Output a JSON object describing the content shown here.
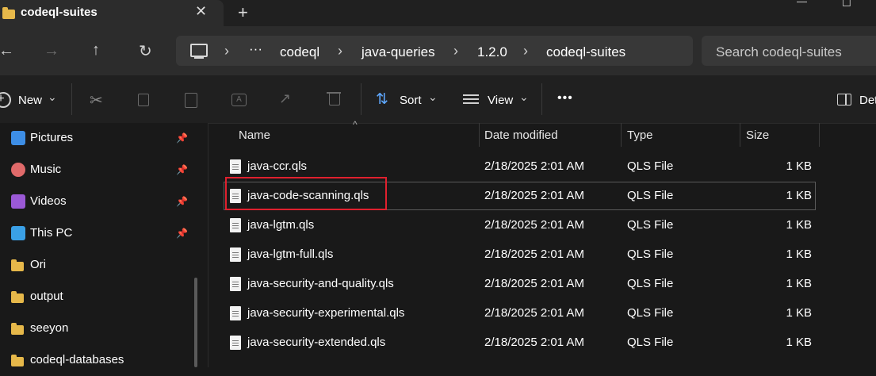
{
  "window": {
    "tab_title": "codeql-suites",
    "close_glyph": "✕",
    "new_tab_glyph": "+",
    "min_glyph": "—",
    "max_glyph": "☐"
  },
  "nav": {
    "back_glyph": "←",
    "forward_glyph": "→",
    "up_glyph": "↑",
    "refresh_glyph": "↻",
    "pc_glyph": "🖵",
    "more_glyph": "···",
    "breadcrumbs": [
      "codeql",
      "java-queries",
      "1.2.0",
      "codeql-suites"
    ],
    "sep_glyph": "›",
    "search_placeholder": "Search codeql-suites"
  },
  "toolbar": {
    "new_label": "New",
    "sort_label": "Sort",
    "view_label": "View",
    "more_glyph": "•••",
    "details_label": "Det",
    "chevron": "⌄"
  },
  "sidebar": {
    "items": [
      {
        "label": "Pictures",
        "pinned": true,
        "icon": "pictures-icon",
        "color": "#3d8ee6"
      },
      {
        "label": "Music",
        "pinned": true,
        "icon": "music-icon",
        "color": "#e06a6a"
      },
      {
        "label": "Videos",
        "pinned": true,
        "icon": "videos-icon",
        "color": "#9b59d6"
      },
      {
        "label": "This PC",
        "pinned": true,
        "icon": "pc-icon",
        "color": "#3aa0e6"
      },
      {
        "label": "Ori",
        "pinned": false,
        "icon": "folder-icon",
        "color": "#e6b84a"
      },
      {
        "label": "output",
        "pinned": false,
        "icon": "folder-icon",
        "color": "#e6b84a"
      },
      {
        "label": "seeyon",
        "pinned": false,
        "icon": "folder-icon",
        "color": "#e6b84a"
      },
      {
        "label": "codeql-databases",
        "pinned": false,
        "icon": "folder-icon",
        "color": "#e6b84a"
      }
    ],
    "pin_glyph": "📌"
  },
  "list": {
    "headers": {
      "name": "Name",
      "date": "Date modified",
      "type": "Type",
      "size": "Size"
    },
    "sort_glyph": "^",
    "files": [
      {
        "name": "java-ccr.qls",
        "date": "2/18/2025 2:01 AM",
        "type": "QLS File",
        "size": "1 KB"
      },
      {
        "name": "java-code-scanning.qls",
        "date": "2/18/2025 2:01 AM",
        "type": "QLS File",
        "size": "1 KB"
      },
      {
        "name": "java-lgtm.qls",
        "date": "2/18/2025 2:01 AM",
        "type": "QLS File",
        "size": "1 KB"
      },
      {
        "name": "java-lgtm-full.qls",
        "date": "2/18/2025 2:01 AM",
        "type": "QLS File",
        "size": "1 KB"
      },
      {
        "name": "java-security-and-quality.qls",
        "date": "2/18/2025 2:01 AM",
        "type": "QLS File",
        "size": "1 KB"
      },
      {
        "name": "java-security-experimental.qls",
        "date": "2/18/2025 2:01 AM",
        "type": "QLS File",
        "size": "1 KB"
      },
      {
        "name": "java-security-extended.qls",
        "date": "2/18/2025 2:01 AM",
        "type": "QLS File",
        "size": "1 KB"
      }
    ],
    "selected_index": 1
  }
}
